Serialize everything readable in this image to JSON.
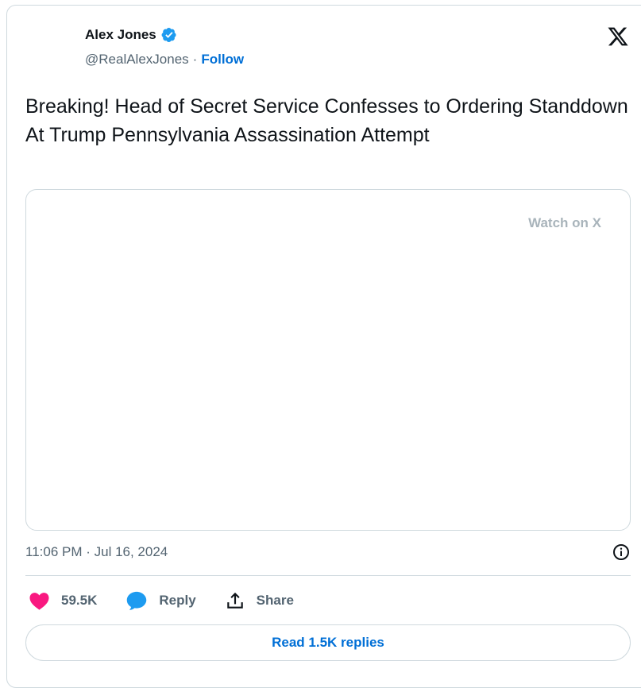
{
  "author": {
    "name": "Alex Jones",
    "handle": "@RealAlexJones",
    "separator": "·",
    "follow_label": "Follow",
    "verified_color": "#1d9bf0"
  },
  "tweet": {
    "text": "Breaking! Head of Secret Service Confesses to Ordering Standdown At Trump Pennsylvania Assassination Attempt"
  },
  "media": {
    "watch_label": "Watch on X"
  },
  "meta": {
    "timestamp": "11:06 PM · Jul 16, 2024"
  },
  "actions": {
    "likes_count": "59.5K",
    "reply_label": "Reply",
    "share_label": "Share"
  },
  "footer": {
    "read_replies_label": "Read 1.5K replies"
  },
  "icons": {
    "brand": "x-logo-icon",
    "verified": "verified-badge-icon",
    "info": "info-icon",
    "like": "heart-icon",
    "reply": "speech-bubble-icon",
    "share": "share-arrow-icon"
  },
  "colors": {
    "accent": "#006fd6",
    "like": "#f91880",
    "reply": "#1d9bf0",
    "muted_text": "#536471",
    "border": "#cfd9de"
  }
}
